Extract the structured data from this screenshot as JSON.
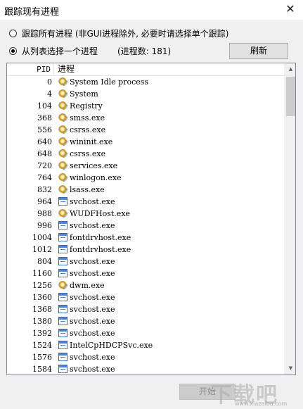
{
  "window": {
    "title": "跟踪现有进程",
    "close_glyph": "✕"
  },
  "options": {
    "trace_all_label": "跟踪所有进程 (非GUI进程除外, 必要时请选择单个跟踪)",
    "select_label": "从列表选择一个进程",
    "process_count": "(进程数: 181)",
    "refresh_label": "刷新",
    "selected": "select"
  },
  "list": {
    "header_pid": "PID",
    "header_name": "进程",
    "rows": [
      {
        "pid": "0",
        "name": "System Idle process",
        "icon": "gear-icon"
      },
      {
        "pid": "4",
        "name": "System",
        "icon": "gear-icon"
      },
      {
        "pid": "104",
        "name": "Registry",
        "icon": "gear-icon"
      },
      {
        "pid": "368",
        "name": "smss.exe",
        "icon": "gear-icon"
      },
      {
        "pid": "556",
        "name": "csrss.exe",
        "icon": "gear-icon"
      },
      {
        "pid": "640",
        "name": "wininit.exe",
        "icon": "gear-icon"
      },
      {
        "pid": "648",
        "name": "csrss.exe",
        "icon": "gear-icon"
      },
      {
        "pid": "720",
        "name": "services.exe",
        "icon": "gear-icon"
      },
      {
        "pid": "764",
        "name": "winlogon.exe",
        "icon": "gear-icon"
      },
      {
        "pid": "832",
        "name": "lsass.exe",
        "icon": "gear-icon"
      },
      {
        "pid": "964",
        "name": "svchost.exe",
        "icon": "window-icon"
      },
      {
        "pid": "988",
        "name": "WUDFHost.exe",
        "icon": "gear-icon"
      },
      {
        "pid": "996",
        "name": "svchost.exe",
        "icon": "window-icon"
      },
      {
        "pid": "1004",
        "name": "fontdrvhost.exe",
        "icon": "window-icon"
      },
      {
        "pid": "1012",
        "name": "fontdrvhost.exe",
        "icon": "window-icon"
      },
      {
        "pid": "804",
        "name": "svchost.exe",
        "icon": "window-icon"
      },
      {
        "pid": "1160",
        "name": "svchost.exe",
        "icon": "window-icon"
      },
      {
        "pid": "1256",
        "name": "dwm.exe",
        "icon": "gear-icon"
      },
      {
        "pid": "1360",
        "name": "svchost.exe",
        "icon": "window-icon"
      },
      {
        "pid": "1368",
        "name": "svchost.exe",
        "icon": "window-icon"
      },
      {
        "pid": "1380",
        "name": "svchost.exe",
        "icon": "window-icon"
      },
      {
        "pid": "1392",
        "name": "svchost.exe",
        "icon": "window-icon"
      },
      {
        "pid": "1524",
        "name": "IntelCpHDCPSvc.exe",
        "icon": "window-icon"
      },
      {
        "pid": "1576",
        "name": "svchost.exe",
        "icon": "window-icon"
      },
      {
        "pid": "1584",
        "name": "svchost.exe",
        "icon": "window-icon"
      }
    ]
  },
  "scrollbar": {
    "up_glyph": "▲",
    "down_glyph": "▼"
  },
  "footer": {
    "start_label": "开始"
  },
  "watermark": {
    "text": "下载吧",
    "url": "www.xiazaiba.com"
  }
}
